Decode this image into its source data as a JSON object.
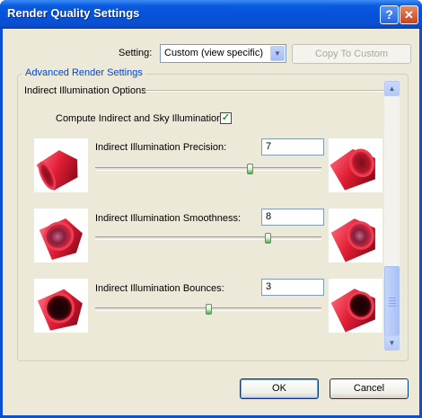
{
  "window": {
    "title": "Render Quality Settings"
  },
  "titlebar": {
    "help_glyph": "?",
    "close_glyph": "✕"
  },
  "setting": {
    "label": "Setting:",
    "value": "Custom (view specific)",
    "dropdown_glyph": "▼"
  },
  "copy_button": {
    "label": "Copy To Custom"
  },
  "group": {
    "title": "Advanced Render Settings"
  },
  "section": {
    "title": "Indirect Illumination Options"
  },
  "compute": {
    "label": "Compute Indirect and Sky Illumination",
    "checked": true,
    "check_glyph": "✓"
  },
  "sliders": [
    {
      "label": "Indirect Illumination Precision:",
      "value": "7",
      "level": 0.69
    },
    {
      "label": "Indirect Illumination Smoothness:",
      "value": "8",
      "level": 0.77
    },
    {
      "label": "Indirect Illumination Bounces:",
      "value": "3",
      "level": 0.5
    }
  ],
  "scrollbar": {
    "up_glyph": "▲",
    "down_glyph": "▼"
  },
  "buttons": {
    "ok": "OK",
    "cancel": "Cancel"
  },
  "colors": {
    "title_blue": "#0a5be0",
    "group_title": "#0046d5",
    "dialog_bg": "#ece9d8",
    "cup_red": "#d8283a"
  }
}
